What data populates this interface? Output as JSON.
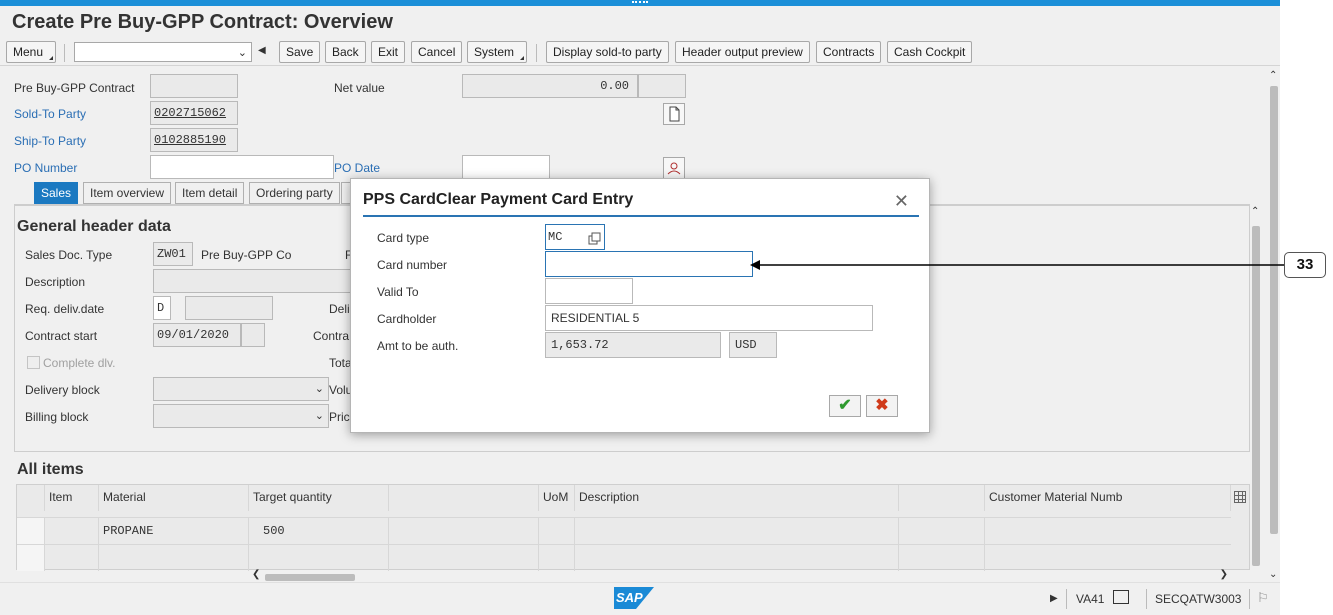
{
  "window": {
    "title": "Create Pre Buy-GPP Contract: Overview"
  },
  "toolbar": {
    "menu": "Menu",
    "save": "Save",
    "back": "Back",
    "exit": "Exit",
    "cancel": "Cancel",
    "system": "System",
    "display_sold_to": "Display sold-to party",
    "header_output": "Header output preview",
    "contracts": "Contracts",
    "cash_cockpit": "Cash Cockpit"
  },
  "header": {
    "contract_label": "Pre Buy-GPP Contract",
    "contract_value": "",
    "net_value_label": "Net value",
    "net_value": "0.00",
    "sold_to_label": "Sold-To Party",
    "sold_to_value": "0202715062",
    "ship_to_label": "Ship-To Party",
    "ship_to_value": "0102885190",
    "po_number_label": "PO Number",
    "po_date_label": "PO Date"
  },
  "tabs": [
    "Sales",
    "Item overview",
    "Item detail",
    "Ordering party"
  ],
  "general": {
    "heading": "General header data",
    "doc_type_label": "Sales Doc. Type",
    "doc_type_code": "ZW01",
    "doc_type_name": "Pre Buy-GPP Co",
    "description_label": "Description",
    "req_deliv_label": "Req. deliv.date",
    "req_deliv_unit": "D",
    "contract_start_label": "Contract start",
    "contract_start_value": "09/01/2020",
    "complete_dlv_label": "Complete dlv.",
    "delivery_block_label": "Delivery block",
    "billing_block_label": "Billing block",
    "trunc_f": "F",
    "trunc_deli": "Deli",
    "trunc_contra": "Contra",
    "trunc_tota": "Tota",
    "trunc_volu": "Volu",
    "trunc_pric": "Pric"
  },
  "items": {
    "heading": "All items",
    "columns": [
      "Item",
      "Material",
      "Target quantity",
      "",
      "UoM",
      "Description",
      "",
      "Customer Material Numb"
    ],
    "rows": [
      {
        "material": "PROPANE",
        "target_qty": "500"
      }
    ]
  },
  "dialog": {
    "title": "PPS CardClear Payment Card Entry",
    "card_type_label": "Card type",
    "card_type_value": "MC",
    "card_number_label": "Card number",
    "card_number_value": "",
    "valid_to_label": "Valid To",
    "valid_to_value": "",
    "cardholder_label": "Cardholder",
    "cardholder_value": "RESIDENTIAL 5",
    "amount_label": "Amt to be auth.",
    "amount_value": "1,653.72",
    "currency": "USD"
  },
  "statusbar": {
    "logo": "SAP",
    "transaction": "VA41",
    "system": "SECQATW3003"
  },
  "callout": {
    "number": "33"
  }
}
